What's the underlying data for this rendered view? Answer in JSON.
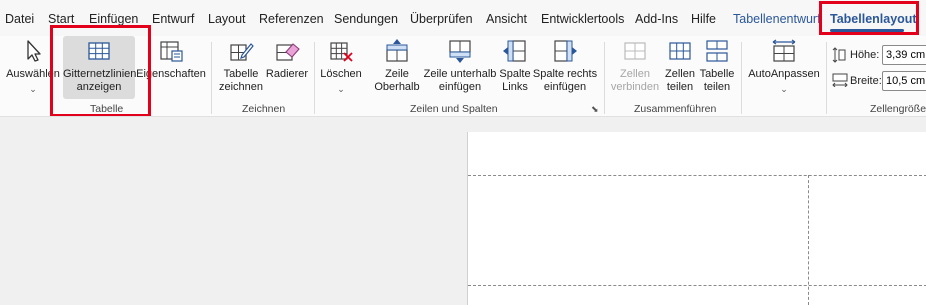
{
  "menu": {
    "tabs": [
      "Datei",
      "Start",
      "Einfügen",
      "Entwurf",
      "Layout",
      "Referenzen",
      "Sendungen",
      "Überprüfen",
      "Ansicht",
      "Entwicklertools",
      "Add-Ins",
      "Hilfe"
    ],
    "context_tabs": [
      "Tabellenentwurf",
      "Tabellenlayout"
    ],
    "active_tab": "Tabellenlayout"
  },
  "ribbon": {
    "tabelle": {
      "group_label": "Tabelle",
      "select_label": "Auswählen",
      "gridlines_label_1": "Gitternetzlinien",
      "gridlines_label_2": "anzeigen",
      "properties_label": "Eigenschaften"
    },
    "zeichnen": {
      "group_label": "Zeichnen",
      "draw_label_1": "Tabelle",
      "draw_label_2": "zeichnen",
      "eraser_label": "Radierer"
    },
    "zeilen_spalten": {
      "group_label": "Zeilen und Spalten",
      "delete_label": "Löschen",
      "row_above_1": "Zeile",
      "row_above_2": "Oberhalb",
      "row_below_1": "Zeile unterhalb",
      "row_below_2": "einfügen",
      "col_left_1": "Spalte",
      "col_left_2": "Links",
      "col_right_1": "Spalte rechts",
      "col_right_2": "einfügen"
    },
    "zusammenfuehren": {
      "group_label": "Zusammenführen",
      "merge_1": "Zellen",
      "merge_2": "verbinden",
      "split_cells_1": "Zellen",
      "split_cells_2": "teilen",
      "split_table_1": "Tabelle",
      "split_table_2": "teilen"
    },
    "zellengroesse": {
      "group_label": "Zellengröße",
      "autofit_label": "AutoAnpassen",
      "height_label": "Höhe:",
      "height_value": "3,39 cm",
      "width_label": "Breite:",
      "width_value": "10,5 cm"
    }
  },
  "colors": {
    "accent": "#2b579a",
    "highlight": "#e3001b"
  }
}
